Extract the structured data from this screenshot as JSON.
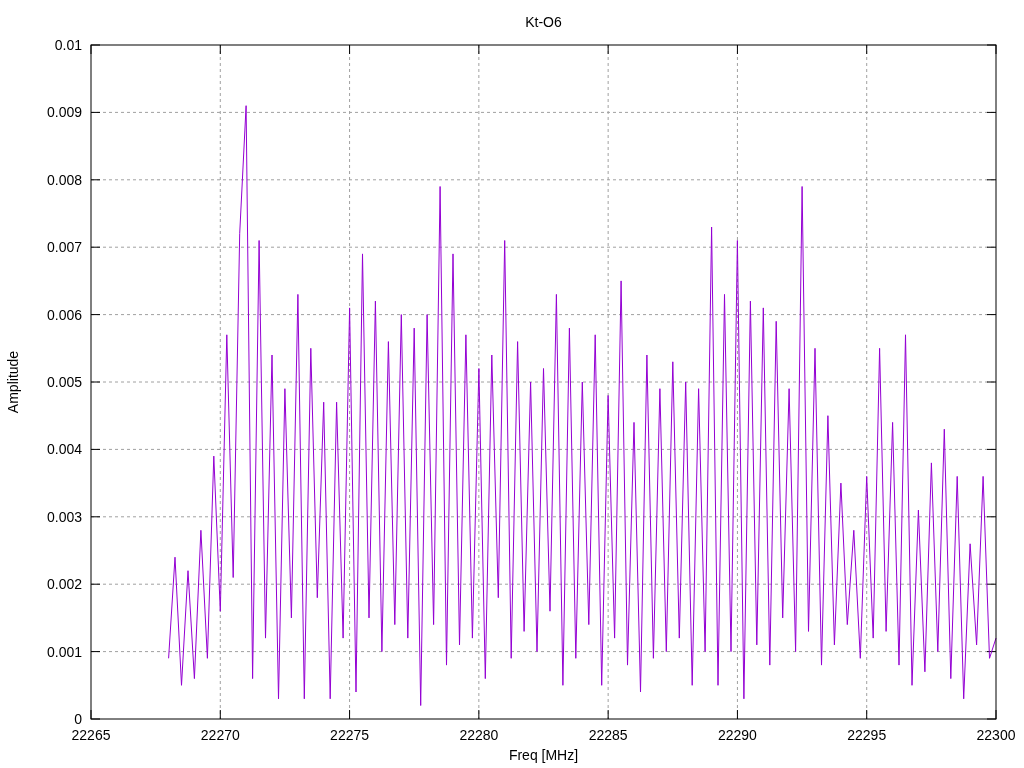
{
  "chart_data": {
    "type": "line",
    "title": "Kt-O6",
    "xlabel": "Freq [MHz]",
    "ylabel": "Amplitude",
    "grid": true,
    "xlim": [
      22265,
      22300
    ],
    "ylim": [
      0,
      0.01
    ],
    "xticks": [
      22265,
      22270,
      22275,
      22280,
      22285,
      22290,
      22295,
      22300
    ],
    "yticks": [
      0,
      0.001,
      0.002,
      0.003,
      0.004,
      0.005,
      0.006,
      0.007,
      0.008,
      0.009,
      0.01
    ],
    "x": [
      22268,
      22268.25,
      22268.5,
      22268.75,
      22269,
      22269.25,
      22269.5,
      22269.75,
      22270,
      22270.25,
      22270.5,
      22270.75,
      22271,
      22271.25,
      22271.5,
      22271.75,
      22272,
      22272.25,
      22272.5,
      22272.75,
      22273,
      22273.25,
      22273.5,
      22273.75,
      22274,
      22274.25,
      22274.5,
      22274.75,
      22275,
      22275.25,
      22275.5,
      22275.75,
      22276,
      22276.25,
      22276.5,
      22276.75,
      22277,
      22277.25,
      22277.5,
      22277.75,
      22278,
      22278.25,
      22278.5,
      22278.75,
      22279,
      22279.25,
      22279.5,
      22279.75,
      22280,
      22280.25,
      22280.5,
      22280.75,
      22281,
      22281.25,
      22281.5,
      22281.75,
      22282,
      22282.25,
      22282.5,
      22282.75,
      22283,
      22283.25,
      22283.5,
      22283.75,
      22284,
      22284.25,
      22284.5,
      22284.75,
      22285,
      22285.25,
      22285.5,
      22285.75,
      22286,
      22286.25,
      22286.5,
      22286.75,
      22287,
      22287.25,
      22287.5,
      22287.75,
      22288,
      22288.25,
      22288.5,
      22288.75,
      22289,
      22289.25,
      22289.5,
      22289.75,
      22290,
      22290.25,
      22290.5,
      22290.75,
      22291,
      22291.25,
      22291.5,
      22291.75,
      22292,
      22292.25,
      22292.5,
      22292.75,
      22293,
      22293.25,
      22293.5,
      22293.75,
      22294,
      22294.25,
      22294.5,
      22294.75,
      22295,
      22295.25,
      22295.5,
      22295.75,
      22296,
      22296.25,
      22296.5,
      22296.75,
      22297,
      22297.25,
      22297.5,
      22297.75,
      22298,
      22298.25,
      22298.5,
      22298.75,
      22299,
      22299.25,
      22299.5,
      22299.75,
      22300
    ],
    "series": [
      {
        "color": "#9400d3",
        "values": [
          0.0009,
          0.0024,
          0.0005,
          0.0022,
          0.0006,
          0.0028,
          0.0009,
          0.0039,
          0.0016,
          0.0057,
          0.0021,
          0.0072,
          0.0091,
          0.0006,
          0.0071,
          0.0012,
          0.0054,
          0.0003,
          0.0049,
          0.0015,
          0.0063,
          0.0003,
          0.0055,
          0.0018,
          0.0047,
          0.0003,
          0.0047,
          0.0012,
          0.0061,
          0.0004,
          0.0069,
          0.0015,
          0.0062,
          0.001,
          0.0056,
          0.0014,
          0.006,
          0.0012,
          0.0058,
          0.0002,
          0.006,
          0.0014,
          0.0079,
          0.0008,
          0.0069,
          0.0011,
          0.0057,
          0.0012,
          0.0052,
          0.0006,
          0.0054,
          0.0018,
          0.0071,
          0.0009,
          0.0056,
          0.0013,
          0.005,
          0.001,
          0.0052,
          0.0016,
          0.0063,
          0.0005,
          0.0058,
          0.0009,
          0.005,
          0.0014,
          0.0057,
          0.0005,
          0.0048,
          0.0012,
          0.0065,
          0.0008,
          0.0044,
          0.0004,
          0.0054,
          0.0009,
          0.0049,
          0.001,
          0.0053,
          0.0012,
          0.005,
          0.0005,
          0.0049,
          0.001,
          0.0073,
          0.0005,
          0.0063,
          0.001,
          0.0071,
          0.0003,
          0.0062,
          0.0011,
          0.0061,
          0.0008,
          0.0059,
          0.0015,
          0.0049,
          0.001,
          0.0079,
          0.0013,
          0.0055,
          0.0008,
          0.0045,
          0.0011,
          0.0035,
          0.0014,
          0.0028,
          0.0009,
          0.0036,
          0.0012,
          0.0055,
          0.0013,
          0.0044,
          0.0008,
          0.0057,
          0.0005,
          0.0031,
          0.0007,
          0.0038,
          0.001,
          0.0043,
          0.0006,
          0.0036,
          0.0003,
          0.0026,
          0.0011,
          0.0036,
          0.0009,
          0.0012
        ]
      }
    ]
  }
}
